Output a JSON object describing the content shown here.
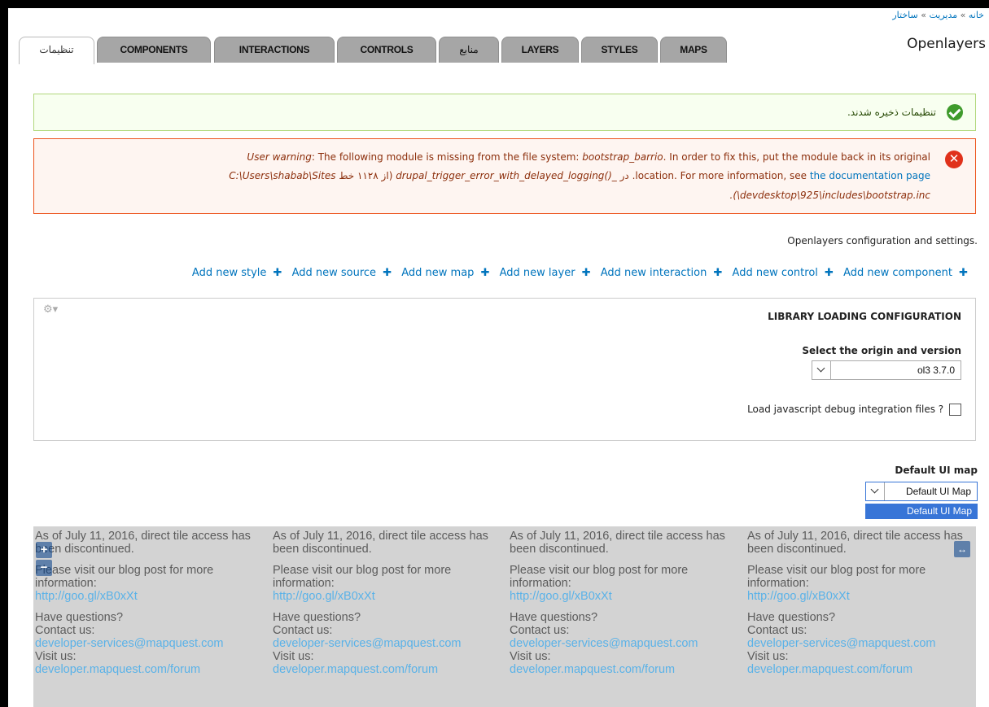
{
  "breadcrumb": {
    "items": [
      "خانه",
      "مدیریت",
      "ساختار"
    ],
    "separator": "»"
  },
  "page_title": "Openlayers",
  "tabs": [
    {
      "label": "تنظیمات",
      "active": true
    },
    {
      "label": "COMPONENTS",
      "active": false
    },
    {
      "label": "INTERACTIONS",
      "active": false
    },
    {
      "label": "CONTROLS",
      "active": false
    },
    {
      "label": "منابع",
      "active": false
    },
    {
      "label": "LAYERS",
      "active": false
    },
    {
      "label": "STYLES",
      "active": false
    },
    {
      "label": "MAPS",
      "active": false
    }
  ],
  "status_message": "تنظیمات ذخیره شدند.",
  "warning": {
    "line1_prefix": "User warning",
    "line1_a": ": The following module is missing from the file system: ",
    "line1_module": "bootstrap_barrio",
    "line1_b": ". In order to fix this, put the module back in its original",
    "line2_path": "C:\\Users\\shabab\\Sites",
    "line2_mid": " از ۱۱۲۸ خط) ",
    "line2_fn": "drupal_trigger_error_with_delayed_logging()",
    "line2_b": "_ در .location. For more information, see ",
    "line2_link": "the documentation page",
    "line3": ".(\\devdesktop\\925\\includes\\bootstrap.inc"
  },
  "intro_text": "Openlayers configuration and settings.",
  "action_links": [
    "Add new style",
    "Add new source",
    "Add new map",
    "Add new layer",
    "Add new interaction",
    "Add new control",
    "Add new component"
  ],
  "library": {
    "title": "LIBRARY LOADING CONFIGURATION",
    "select_label": "Select the origin and version",
    "select_value": "ol3 3.7.0",
    "debug_label": "Load javascript debug integration files ?"
  },
  "ui_map": {
    "label": "Default UI map",
    "select_value": "Default UI Map",
    "dropdown_option": "Default UI Map"
  },
  "map_tile": {
    "line1": "As of July 11, 2016, direct tile access has been discontinued.",
    "line2": "Please visit our blog post for more information:",
    "link1": "http://goo.gl/xB0xXt",
    "line3": "Have questions?",
    "line4": "Contact us:",
    "link2": "developer-services@mapquest.com",
    "line5": "Visit us:",
    "link3": "developer.mapquest.com/forum"
  },
  "map_controls": {
    "zoom_in": "+",
    "zoom_out": "−",
    "fullscreen": "↔"
  },
  "colors": {
    "link": "#0074bd",
    "tab_inactive": "#a6a6a6",
    "ok_border": "#b1d87c",
    "error_border": "#ed541d",
    "map_bg": "#d3d3d3",
    "map_link": "#5ab2e8"
  }
}
